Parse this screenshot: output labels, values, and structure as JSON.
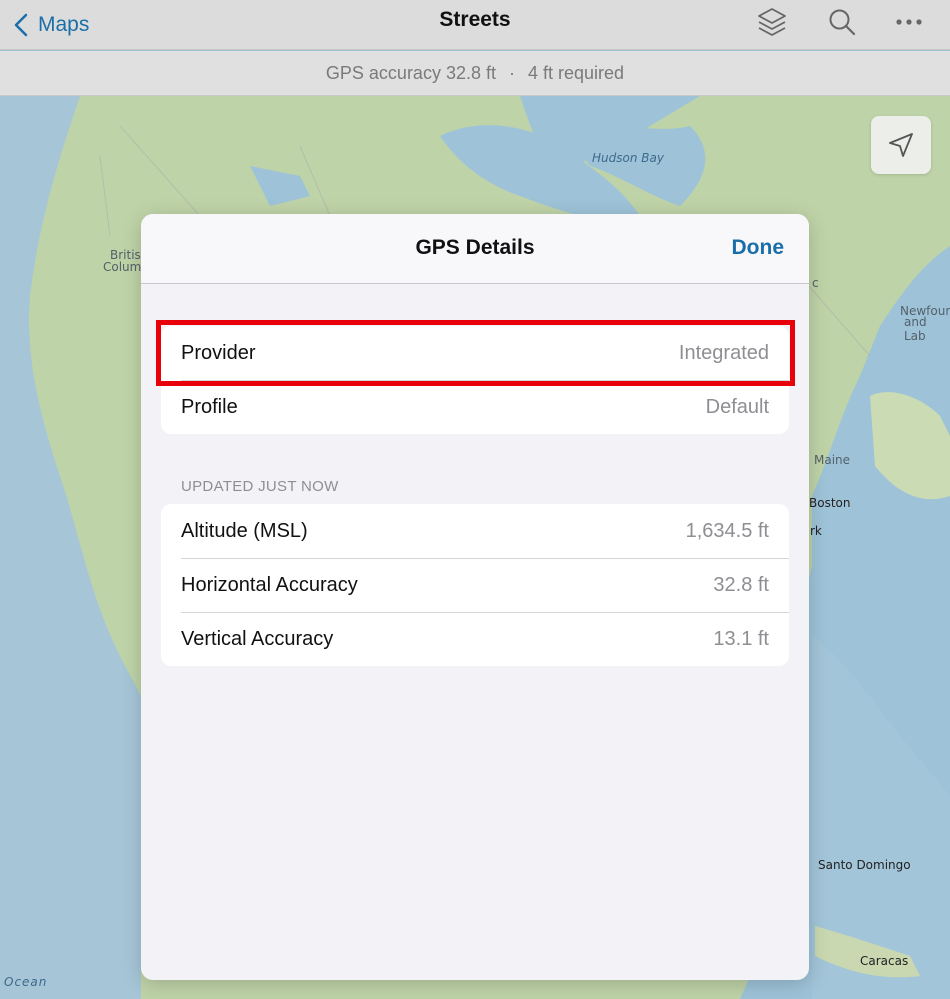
{
  "nav": {
    "back_label": "Maps",
    "title": "Streets",
    "icons": [
      "layers-icon",
      "search-icon",
      "more-icon"
    ]
  },
  "gps_bar": {
    "accuracy": "GPS accuracy 32.8 ft",
    "separator": "·",
    "required": "4 ft required"
  },
  "map": {
    "labels": {
      "hudson_bay": "Hudson Bay",
      "british_columbia_1": "Britis",
      "british_columbia_2": "Colum",
      "quebec_fragment": "c",
      "newfoundland_1": "Newfoun",
      "newfoundland_2": "and Lab",
      "maine": "Maine",
      "boston": "Boston",
      "new_york_fragment": "rk",
      "santo_domingo": "Santo Domingo",
      "caracas": "Caracas",
      "ocean": "Ocean"
    }
  },
  "modal": {
    "title": "GPS Details",
    "done_label": "Done",
    "source_group": [
      {
        "label": "Provider",
        "value": "Integrated"
      },
      {
        "label": "Profile",
        "value": "Default"
      }
    ],
    "section_header": "UPDATED JUST NOW",
    "metrics": [
      {
        "label": "Altitude (MSL)",
        "value": "1,634.5 ft"
      },
      {
        "label": "Horizontal Accuracy",
        "value": "32.8 ft"
      },
      {
        "label": "Vertical Accuracy",
        "value": "13.1 ft"
      }
    ]
  },
  "colors": {
    "accent": "#1a6fa8",
    "highlight": "#e8000b",
    "secondary_text": "#8e8e93"
  }
}
